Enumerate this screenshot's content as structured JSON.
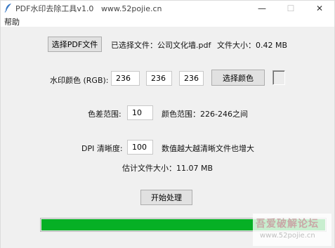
{
  "window": {
    "title": "PDF水印去除工具v1.0",
    "title_site": "www.52pojie.cn",
    "minimize_glyph": "—",
    "maximize_glyph": "☐",
    "close_glyph": "✕"
  },
  "menu": {
    "help": "帮助"
  },
  "file": {
    "select_button": "选择PDF文件",
    "selected_label": "已选择文件：公司文化墙.pdf",
    "size_label": "文件大小：0.42 MB"
  },
  "watermark_color": {
    "label": "水印颜色 (RGB):",
    "r": "236",
    "g": "236",
    "b": "236",
    "pick_button": "选择颜色",
    "swatch_color": "#ececec"
  },
  "tolerance": {
    "label": "色差范围:",
    "value": "10",
    "range_text": "颜色范围：226-246之间"
  },
  "dpi": {
    "label": "DPI 清晰度:",
    "value": "100",
    "hint": "数值越大越清晰文件也增大"
  },
  "estimate": {
    "text": "估计文件大小：11.07 MB"
  },
  "actions": {
    "start_button": "开始处理"
  },
  "progress": {
    "percent": 100,
    "color": "#06b025"
  },
  "overlay_watermark": {
    "main": "吾爱破解论坛",
    "url": "www.52pojie.cn"
  },
  "icons": {
    "app": "feather-icon"
  }
}
